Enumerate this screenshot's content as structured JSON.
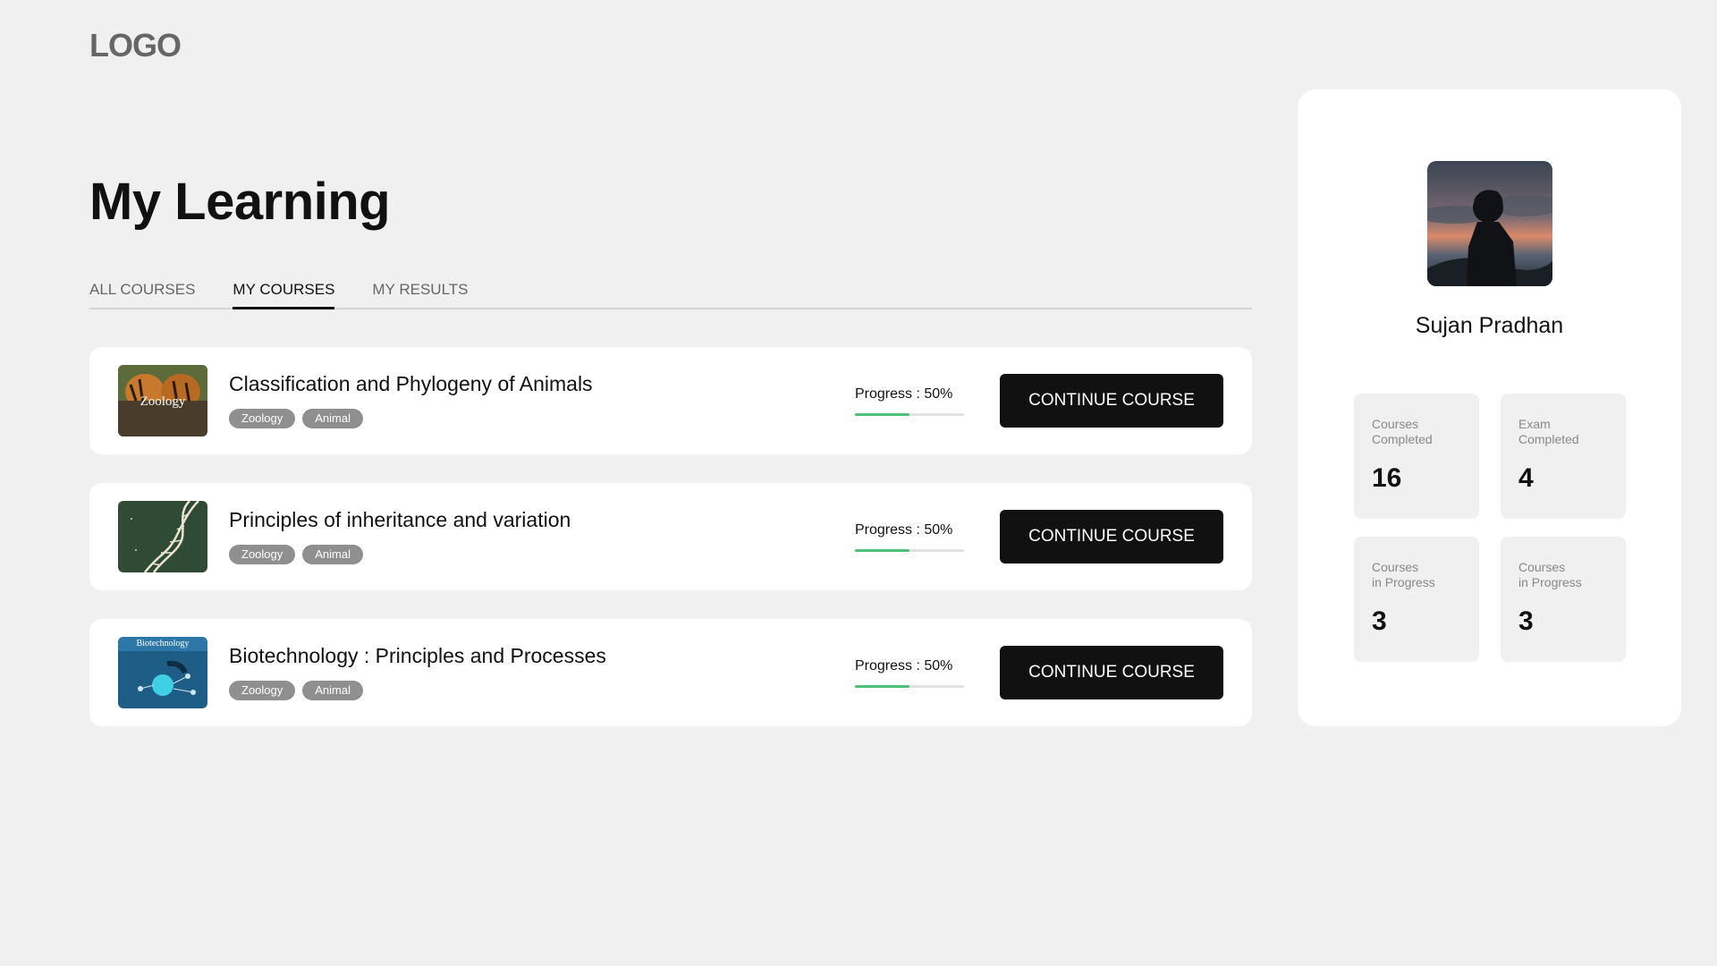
{
  "logo": "LOGO",
  "page_title": "My Learning",
  "tabs": [
    {
      "label": "ALL COURSES",
      "active": false
    },
    {
      "label": "MY COURSES",
      "active": true
    },
    {
      "label": "MY RESULTS",
      "active": false
    }
  ],
  "courses": [
    {
      "title": "Classification and Phylogeny of Animals",
      "tags": [
        "Zoology",
        "Animal"
      ],
      "progress_label": "Progress : 50%",
      "progress_fraction": 0.5,
      "button_label": "CONTINUE COURSE",
      "thumbnail_text": "Zoology"
    },
    {
      "title": "Principles of inheritance and variation",
      "tags": [
        "Zoology",
        "Animal"
      ],
      "progress_label": "Progress : 50%",
      "progress_fraction": 0.5,
      "button_label": "CONTINUE COURSE"
    },
    {
      "title": "Biotechnology : Principles and Processes",
      "tags": [
        "Zoology",
        "Animal"
      ],
      "progress_label": "Progress : 50%",
      "progress_fraction": 0.5,
      "button_label": "CONTINUE COURSE",
      "thumbnail_text": "Biotechnology"
    }
  ],
  "profile": {
    "name": "Sujan Pradhan",
    "stats": [
      {
        "label_line1": "Courses",
        "label_line2": "Completed",
        "value": "16"
      },
      {
        "label_line1": "Exam",
        "label_line2": "Completed",
        "value": "4"
      },
      {
        "label_line1": "Courses",
        "label_line2": "in Progress",
        "value": "3"
      },
      {
        "label_line1": "Courses",
        "label_line2": "in Progress",
        "value": "3"
      }
    ]
  },
  "colors": {
    "background": "#f0f0f0",
    "card": "#ffffff",
    "button": "#111111",
    "progress": "#4fc07a",
    "tag": "#8f8f8f"
  }
}
